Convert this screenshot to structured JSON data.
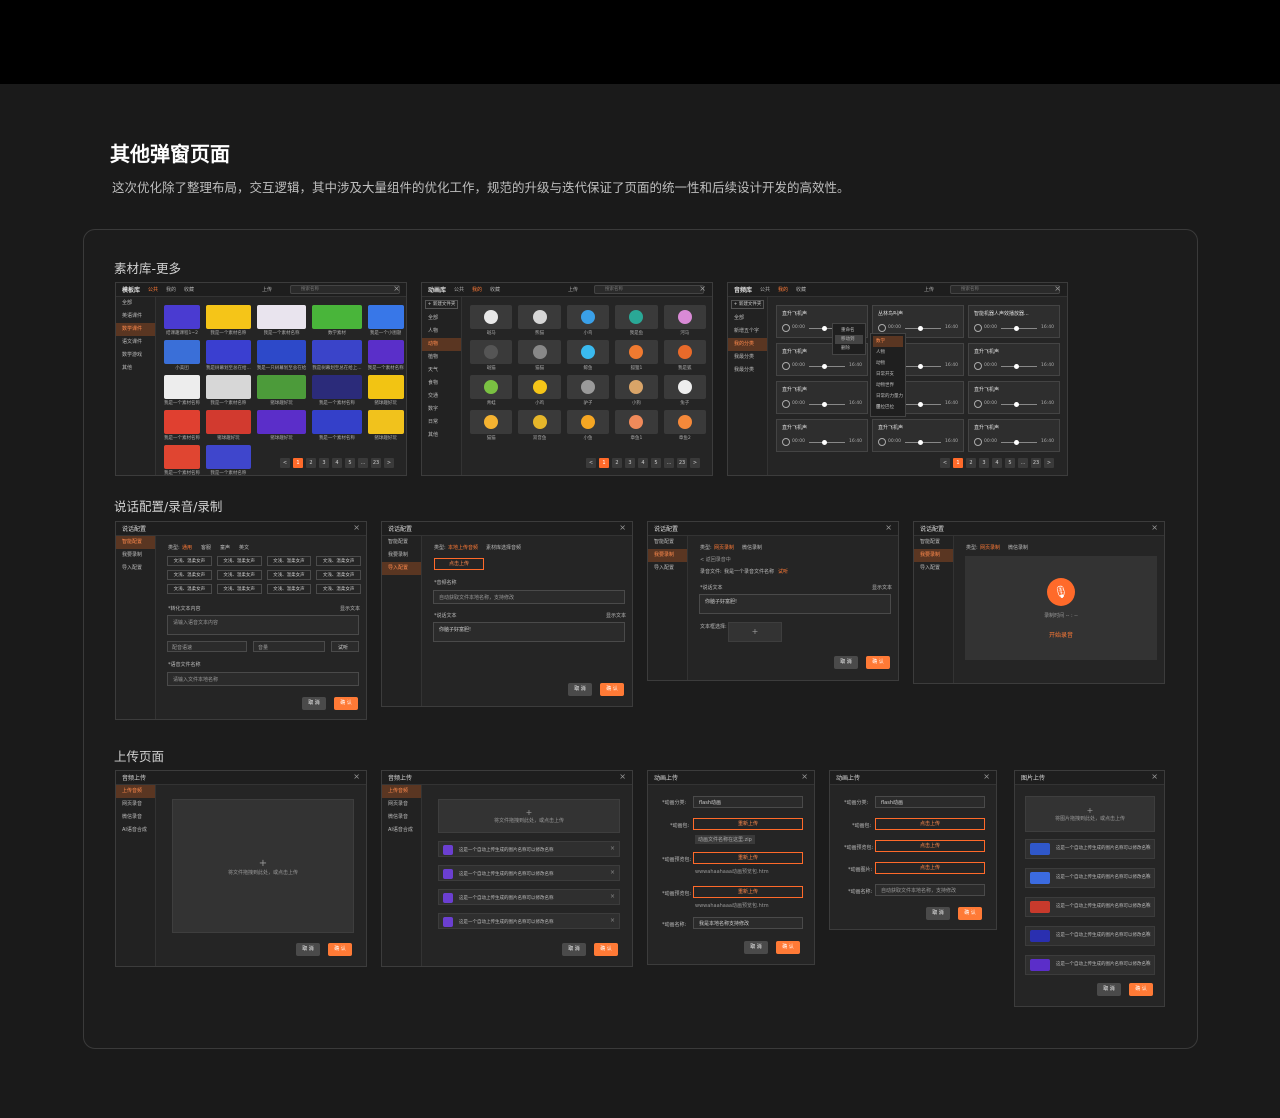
{
  "title": "其他弹窗页面",
  "subtitle": "这次优化除了整理布局，交互逻辑，其中涉及大量组件的优化工作，规范的升级与迭代保证了页面的统一性和后续设计开发的高效性。",
  "sections": {
    "s1": "素材库-更多",
    "s2": "说话配置/录音/录制",
    "s3": "上传页面"
  },
  "common": {
    "search": "搜索名称",
    "upload": "上传",
    "cancel": "取 消",
    "confirm": "确 认",
    "close": "×",
    "public": "公共",
    "mine": "我的",
    "fav": "收藏",
    "new_folder": "+ 新建文件夹"
  },
  "pagination": [
    "<",
    "1",
    "2",
    "3",
    "4",
    "5",
    "...",
    "23",
    ">"
  ],
  "tpl": {
    "title": "模板库",
    "side": [
      "全部",
      "英语课件",
      "数学课件",
      "语文课件",
      "数学游戏",
      "其他"
    ],
    "caps": [
      "结课趣课程1~2",
      "我是一个素材名称",
      "我是一个素材名称",
      "数学素材",
      "我是一个小图题",
      "小美团",
      "我是树幕划至总在给...",
      "我是一只树幕划至总在给",
      "我是树幕划至总在给上...",
      "我是一个素材名称",
      "我是一个素材名称",
      "我是一个素材名称",
      "猪球趣好玩",
      "我是一个素材名称",
      "猪球趣好玩",
      "我是一个素材名称",
      "猪球趣好玩",
      "猪球趣好玩",
      "我是一个素材名称",
      "猪球趣好玩",
      "我是一个素材名称",
      "我是一个素材名称"
    ],
    "colors": [
      "#4a3bd1",
      "#f5c518",
      "#e9e4ee",
      "#49b53a",
      "#3877e8",
      "#3a6fd8",
      "#3a3fd0",
      "#2d49c9",
      "#3a44c9",
      "#5a2fc9",
      "#ededed",
      "#d7d7d7",
      "#4c9b3a",
      "#2b2b7a",
      "#f2c413",
      "#e04030",
      "#d23a2f",
      "#5b2ec9",
      "#3440c9",
      "#f1c21c",
      "#e04531",
      "#3f46cc"
    ]
  },
  "anim": {
    "title": "动画库",
    "side": [
      "全部",
      "人物",
      "动物",
      "植物",
      "天气",
      "食物",
      "交通",
      "数字",
      "日常",
      "其他"
    ],
    "caps": [
      "斑马",
      "熊猫",
      "小鸟",
      "我是鱼",
      "河马",
      "斑猫",
      "猫猫",
      "鲸鱼",
      "狐狸1",
      "我是狐",
      "青蛙",
      "小鸡",
      "驴子",
      "小狗",
      "兔子",
      "猫猫",
      "双音鱼",
      "小鱼",
      "章鱼1",
      "章鱼2"
    ],
    "colors": [
      "#e8e8e8",
      "#d6d6d6",
      "#3aa0e8",
      "#2aa896",
      "#d98ad6",
      "#555",
      "#888",
      "#3abaef",
      "#f07a30",
      "#e86a2a",
      "#7ac142",
      "#f5c518",
      "#9a9a9a",
      "#d9a468",
      "#eee",
      "#f5b331",
      "#e6b62a",
      "#f5a623",
      "#f08a5a",
      "#f5893a"
    ]
  },
  "audio": {
    "title": "音频库",
    "side": [
      "全部",
      "新增五个字",
      "我的分类",
      "我最分类",
      "我最分类"
    ],
    "names": [
      "直升飞机声",
      "丛林鸟叫声",
      "智能机器人声效播放器...",
      "直升飞机声",
      "直升飞机声",
      "直升飞机声",
      "直升飞机声",
      "直升飞机声",
      "直升飞机声",
      "直升飞机声",
      "直升飞机声",
      "直升飞机声"
    ],
    "t0": "00:00",
    "t1": "16:40",
    "ctx": [
      "重命名",
      "移动到",
      "删除"
    ],
    "move": [
      "数学",
      "人物",
      "动物",
      "日常开支",
      "动物世界",
      "日常的力量力量",
      "巴拉巴拉"
    ],
    "use": "使用"
  },
  "cfg1": {
    "title": "说话配置",
    "side": [
      "智能配置",
      "我要录制",
      "导入配置"
    ],
    "type": "类型:",
    "types": [
      "通用",
      "客服",
      "童声",
      "英文"
    ],
    "voices": [
      "文浅、温柔女声",
      "文浅、温柔女声",
      "文浅、温柔女声",
      "文浅、温柔女声",
      "文浅、温柔女声",
      "文浅、温柔女声",
      "文浅、温柔女声",
      "文浅、温柔女声",
      "文浅、温柔女声",
      "文浅、温柔女声",
      "文浅、温柔女声",
      "文浅、温柔女声"
    ],
    "txt_label": "*转化文本内容",
    "show": "显示文本",
    "txt_ph": "请输入语音文本内容",
    "speed": "配音语速",
    "vol": "音量",
    "test": "试听",
    "file_label": "*语音文件名称",
    "file_ph": "请输入文件本地名称"
  },
  "cfg2": {
    "title": "说话配置",
    "types": [
      "本地上传音频",
      "素材库选择音频"
    ],
    "upload": "点击上传",
    "name_label": "*音频名称",
    "name_ph": "自动获取文件本地名称，支持修改",
    "txt_label": "*说话文本",
    "show": "显示文本",
    "txt": "你脑子好富胆!"
  },
  "cfg3": {
    "title": "说话配置",
    "types": [
      "网页录制",
      "微信录制"
    ],
    "back": "< 返回录音中",
    "file": "录音文件:",
    "fname": "我是一个录音文件名称",
    "retry": "试听",
    "txt_label": "*说话文本",
    "show": "显示文本",
    "txt": "你脑子好富胆!",
    "sel": "文本框选择:"
  },
  "cfg4": {
    "title": "说话配置",
    "types": [
      "网页录制",
      "微信录制"
    ],
    "time": "录制时间 -- : --",
    "start": "开始录音"
  },
  "up1": {
    "title": "音频上传",
    "side": [
      "上传音频",
      "网页录音",
      "微信录音",
      "AI语音合成"
    ],
    "drop": "将文件拖拽到此处，或点击上传"
  },
  "up2": {
    "title": "音频上传",
    "side": [
      "上传音频",
      "网页录音",
      "微信录音",
      "AI语音合成"
    ],
    "drop": "将文件拖拽到此处，或点击上传",
    "row": "这是一个自动上传生成的图片名称可以修改名称"
  },
  "up3": {
    "title": "动画上传",
    "cat_l": "*动画分类:",
    "cat": "flash动画",
    "anim_l": "*动画包:",
    "reup": "重新上传",
    "file": "动画文件名称在这里.zip",
    "pre_l": "*动画预览包:",
    "pre_f": "wwwahaahaaa动画预览包.htm",
    "pre2_l": "*动画预览包:",
    "name_l": "*动画名称:",
    "name": "我是本地名称支持修改"
  },
  "up4": {
    "title": "动画上传",
    "cat_l": "*动画分类:",
    "cat": "flash动画",
    "anim_l": "*动画包:",
    "click": "点击上传",
    "pre_l": "*动画预览包:",
    "img_l": "*动画图片:",
    "name_l": "*动画名称:",
    "name_ph": "自动获取文件本地名称，支持修改"
  },
  "up5": {
    "title": "图片上传",
    "drop": "将图片拖拽到此处，或点击上传",
    "row": "这是一个自动上传生成的图片名称可以修改名称"
  }
}
